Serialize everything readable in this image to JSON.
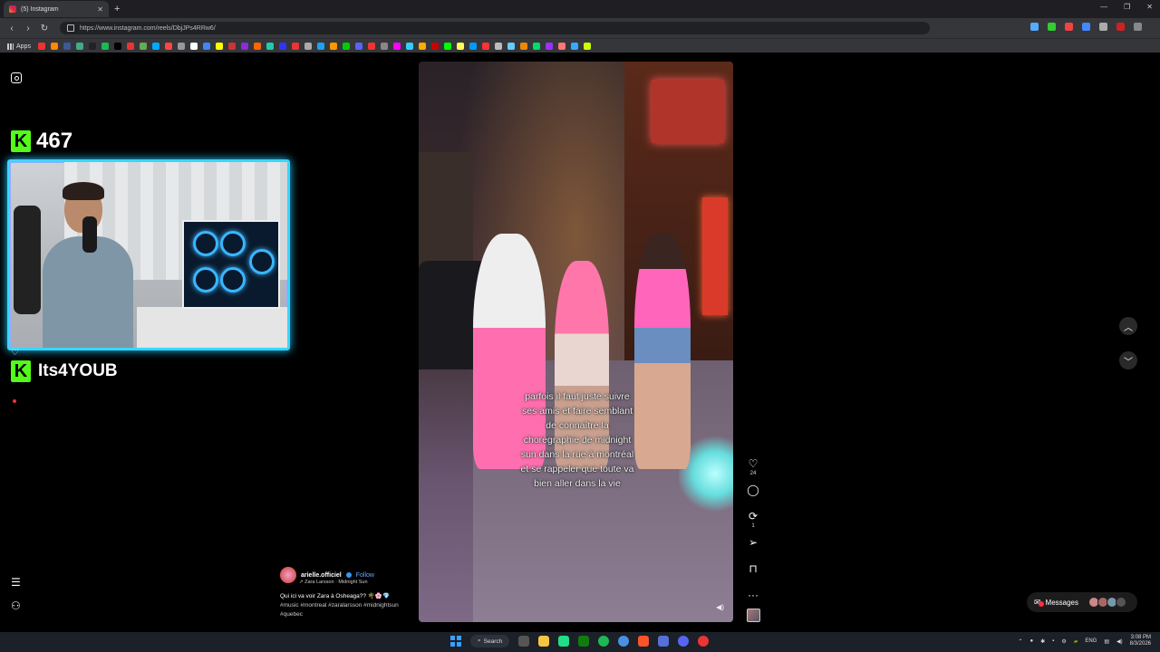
{
  "browser": {
    "tab_title": "(5) Instagram",
    "url": "https://www.instagram.com/reels/DbjJPs4RRw6/",
    "bookmarks_apps_label": "Apps",
    "bookmark_colors": [
      "#e33",
      "#f80",
      "#3b5998",
      "#4a8",
      "#222",
      "#1db954",
      "#000",
      "#e33",
      "#6a5",
      "#0af",
      "#f44",
      "#999",
      "#fff",
      "#4285f4",
      "#ff0",
      "#c33",
      "#8a2be2",
      "#f60",
      "#2ca",
      "#33f",
      "#e33",
      "#aaa",
      "#1da1f2",
      "#f90",
      "#0c0",
      "#5865f2",
      "#e33",
      "#888",
      "#f0f",
      "#3cf",
      "#fa0",
      "#c00",
      "#0f0",
      "#ff5",
      "#09f",
      "#f33",
      "#bbb",
      "#6cf",
      "#e80",
      "#0d6",
      "#93f",
      "#f77",
      "#3af",
      "#cf0"
    ]
  },
  "page": {
    "stream_overlay": {
      "viewer_count": "467",
      "kick_logo": "K",
      "streamer_name": "Its4YOUB"
    },
    "reel": {
      "caption": "parfois il faut juste suivre ses amis et faire semblant de connaître la chorégraphie de midnight sun dans la rue à montréal et se rappeler que toute va bien aller dans la vie",
      "author": "arielle.officiel",
      "follow_label": "Follow",
      "song": "↗ Zara Larsson · Midnight Sun",
      "description": "Qui ici va voir Zara à Osheaga?? 🌴🌸💎",
      "hashtags": "#music #montreal #zaralarsson #midnightsun #quebec",
      "like_count": "24",
      "repost_count": "1"
    },
    "messages_label": "Messages"
  },
  "taskbar": {
    "search_label": "Search",
    "lang": "ENG",
    "time": "3:08 PM",
    "date": "8/3/2026"
  },
  "colors": {
    "accent_kick": "#53fc18",
    "webcam_border": "#38d6ff",
    "instagram_link": "#6aa8ff"
  }
}
